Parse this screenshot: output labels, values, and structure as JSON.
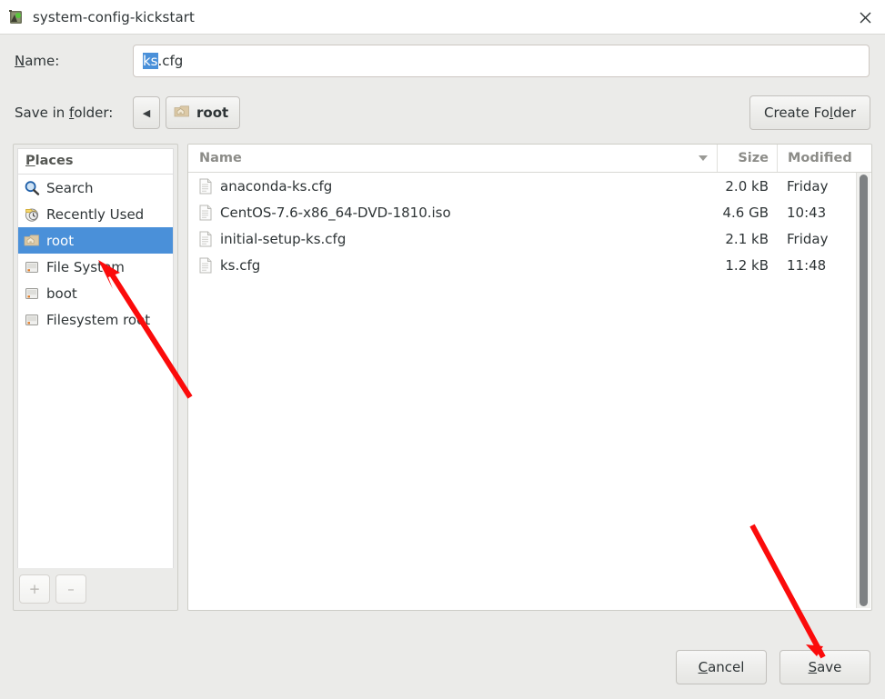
{
  "window": {
    "title": "system-config-kickstart",
    "icon": "app-icon",
    "close_label": "×"
  },
  "name_field": {
    "label_prefix": "N",
    "label_mnemonic": "N",
    "label_rest": "ame:",
    "label_full": "Name:",
    "selected_text": "ks",
    "rest_text": ".cfg",
    "value": "ks.cfg"
  },
  "folder_row": {
    "label": "Save in folder:",
    "label_pre": "Save in ",
    "label_mnemonic": "f",
    "label_post": "older:",
    "back_icon": "◀",
    "crumb_label": "root",
    "create_folder": {
      "pre": "Create Fo",
      "mnemonic": "l",
      "post": "der",
      "full": "Create Folder"
    }
  },
  "places": {
    "header": "Places",
    "header_mnemonic": "P",
    "header_rest": "laces",
    "items": [
      {
        "label": "Search",
        "icon": "search-icon",
        "selected": false
      },
      {
        "label": "Recently Used",
        "icon": "recent-icon",
        "selected": false
      },
      {
        "label": "root",
        "icon": "home-folder-icon",
        "selected": true
      },
      {
        "label": "File System",
        "icon": "drive-icon",
        "selected": false
      },
      {
        "label": "boot",
        "icon": "drive-icon",
        "selected": false
      },
      {
        "label": "Filesystem root",
        "icon": "drive-icon",
        "selected": false
      }
    ],
    "add_label": "+",
    "remove_label": "–"
  },
  "file_list": {
    "columns": [
      "Name",
      "Size",
      "Modified"
    ],
    "sort_column": "Name",
    "sort_direction": "descending",
    "rows": [
      {
        "name": "anaconda-ks.cfg",
        "size": "2.0 kB",
        "modified": "Friday"
      },
      {
        "name": "CentOS-7.6-x86_64-DVD-1810.iso",
        "size": "4.6 GB",
        "modified": "10:43"
      },
      {
        "name": "initial-setup-ks.cfg",
        "size": "2.1 kB",
        "modified": "Friday"
      },
      {
        "name": "ks.cfg",
        "size": "1.2 kB",
        "modified": "11:48"
      }
    ]
  },
  "actions": {
    "cancel": {
      "pre": "",
      "mnemonic": "C",
      "post": "ancel",
      "full": "Cancel"
    },
    "save": {
      "pre": "",
      "mnemonic": "S",
      "post": "ave",
      "full": "Save"
    }
  },
  "colors": {
    "selection_blue": "#4a90d9",
    "annotation_red": "#fb0b0b",
    "dialog_bg": "#ebebe9",
    "list_bg": "#ffffff"
  }
}
